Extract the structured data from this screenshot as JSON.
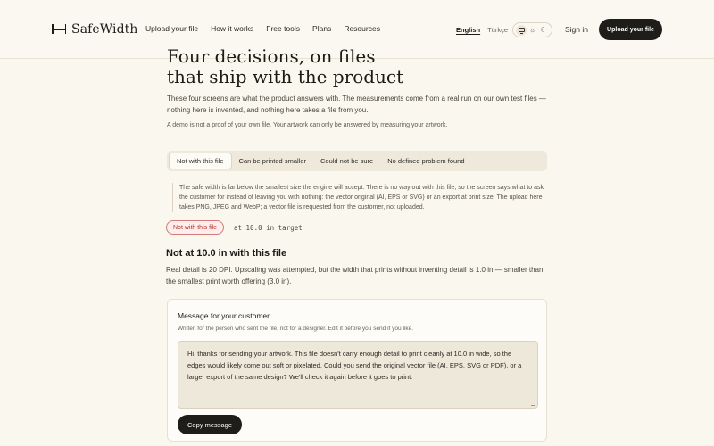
{
  "header": {
    "brand": "SafeWidth",
    "nav": [
      "Upload your file",
      "How it works",
      "Free tools",
      "Plans",
      "Resources"
    ],
    "lang_active": "English",
    "lang_other": "Türkçe",
    "theme_icons": [
      "monitor-icon",
      "sun-icon",
      "moon-icon"
    ],
    "sun_glyph": "☼",
    "moon_glyph": "☾",
    "signin": "Sign in",
    "upload_button": "Upload your file"
  },
  "main": {
    "title_line1": "Four decisions, on files",
    "title_line2": "that ship with the product",
    "intro": "These four screens are what the product answers with. The measurements come from a real run on our own test files — nothing here is invented, and nothing here takes a file from you.",
    "demo_note": "A demo is not a proof of your own file. Your artwork can only be answered by measuring your artwork.",
    "tabs": [
      "Not with this file",
      "Can be printed smaller",
      "Could not be sure",
      "No defined problem found"
    ],
    "active_tab": 0,
    "quote": "The safe width is far below the smallest size the engine will accept. There is no way out with this file, so the screen says what to ask the customer for instead of leaving you with nothing: the vector original (AI, EPS or SVG) or an export at print size. The upload here takes PNG, JPEG and WebP; a vector file is requested from the customer, not uploaded.",
    "badge": "Not with this file",
    "target": "at 10.0 in target",
    "heading": "Not at 10.0 in with this file",
    "explanation": "Real detail is 20 DPI. Upscaling was attempted, but the width that prints without inventing detail is 1.0 in — smaller than the smallest print worth offering (3.0 in).",
    "card": {
      "title": "Message for your customer",
      "subtitle": "Written for the person who sent the file, not for a designer. Edit it before you send if you like.",
      "message": "Hi, thanks for sending your artwork. This file doesn't carry enough detail to print cleanly at 10.0 in wide, so the edges would likely come out soft or pixelated. Could you send the original vector file (AI, EPS, SVG or PDF), or a larger export of the same design? We'll check it again before it goes to print.",
      "copy_button": "Copy message"
    }
  },
  "colors": {
    "background": "#faf7ef",
    "primary_dark": "#1f1d19",
    "badge_red": "#b8342e",
    "tab_bar": "#efe9dc"
  }
}
